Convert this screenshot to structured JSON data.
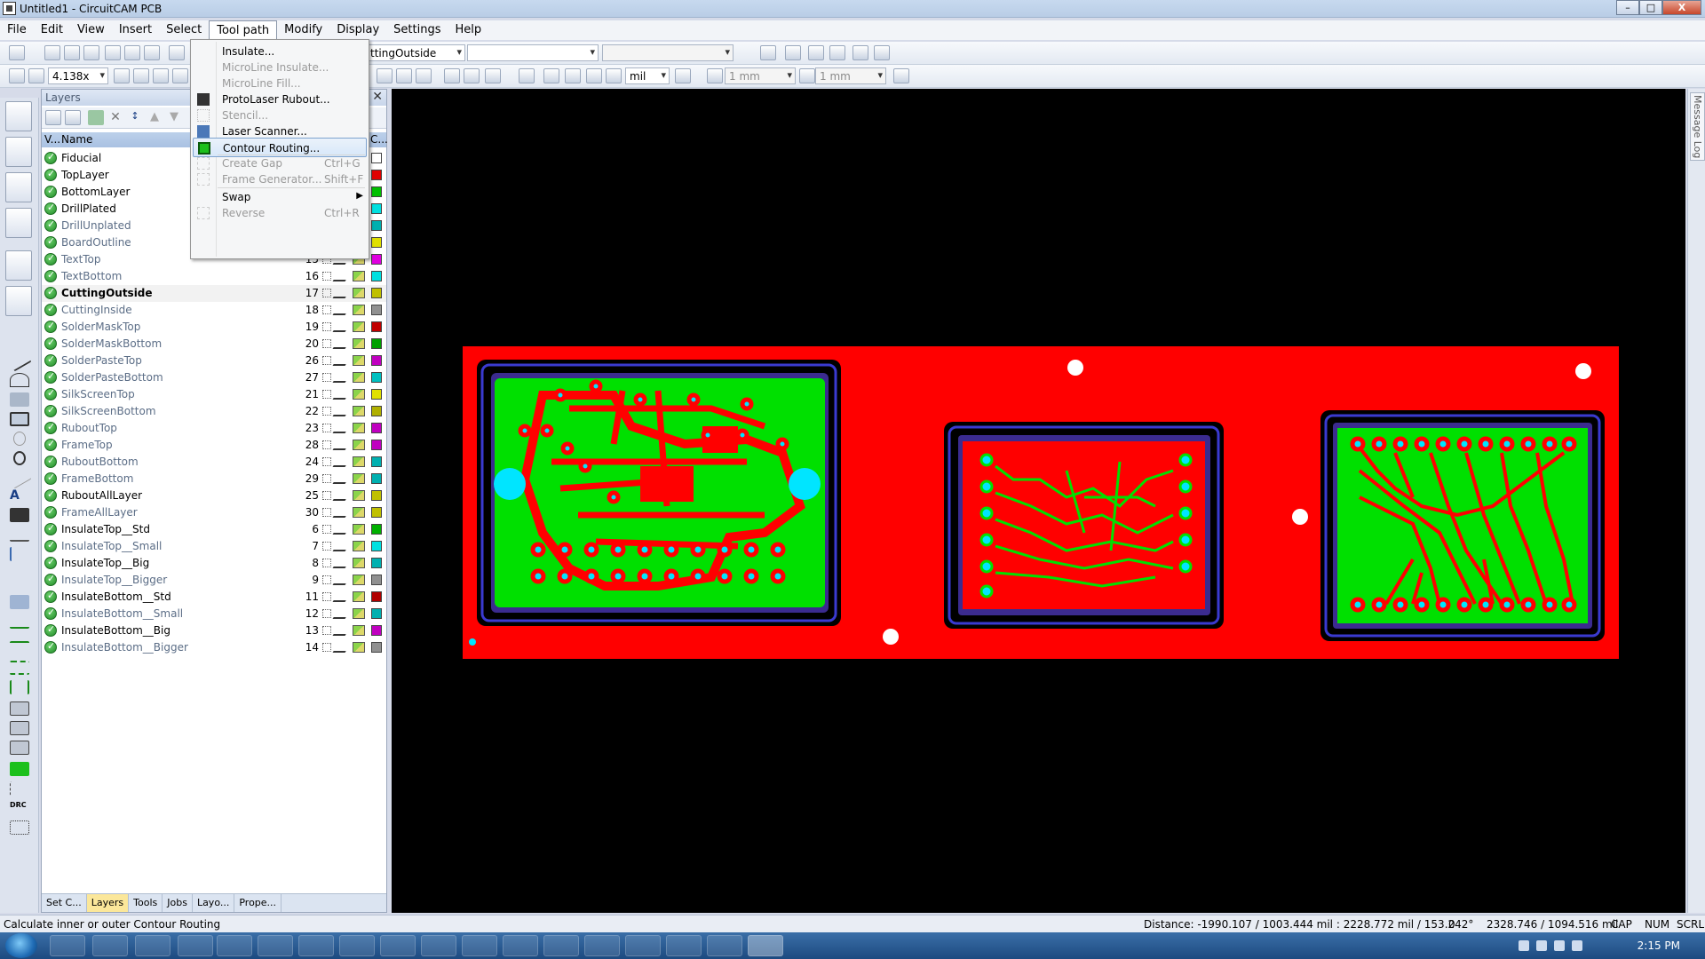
{
  "window": {
    "title": "Untitled1 - CircuitCAM PCB",
    "buttons": {
      "minimize": "–",
      "maximize": "□",
      "close": "X"
    }
  },
  "menubar": {
    "items": [
      "File",
      "Edit",
      "View",
      "Insert",
      "Select",
      "Tool path",
      "Modify",
      "Display",
      "Settings",
      "Help"
    ],
    "open_item": "Tool path"
  },
  "toolpath_menu": {
    "items": [
      {
        "label": "Insulate...",
        "shortcut": "",
        "enabled": true,
        "icon": "insulate-icon"
      },
      {
        "label": "MicroLine Insulate...",
        "shortcut": "",
        "enabled": false,
        "icon": ""
      },
      {
        "label": "MicroLine Fill...",
        "shortcut": "",
        "enabled": false,
        "icon": ""
      },
      {
        "label": "ProtoLaser Rubout...",
        "shortcut": "",
        "enabled": true,
        "icon": "rubout-icon"
      },
      {
        "label": "Stencil...",
        "shortcut": "",
        "enabled": false,
        "icon": "stencil-icon"
      },
      {
        "label": "Laser Scanner...",
        "shortcut": "",
        "enabled": true,
        "icon": "laser-scanner-icon"
      },
      {
        "label": "Contour Routing...",
        "shortcut": "",
        "enabled": true,
        "highlighted": true,
        "icon": "contour-routing-icon"
      },
      {
        "label": "Create Gap",
        "shortcut": "Ctrl+G",
        "enabled": false,
        "icon": "create-gap-icon"
      },
      {
        "label": "Frame Generator...",
        "shortcut": "Shift+F",
        "enabled": false,
        "icon": "frame-generator-icon"
      },
      {
        "label": "Swap",
        "shortcut": "",
        "enabled": true,
        "submenu": true,
        "icon": ""
      },
      {
        "label": "Reverse",
        "shortcut": "Ctrl+R",
        "enabled": false,
        "icon": "reverse-icon"
      }
    ]
  },
  "toolbar": {
    "layer_combo": "ttingOutside",
    "zoom_combo": "4.138x",
    "unit_combo": "mil",
    "grid_combo": "1 mm",
    "snap_combo": "1 mm",
    "empty_combo": ""
  },
  "layers_panel": {
    "title": "Layers",
    "columns": {
      "visible": "V...",
      "name": "Name",
      "color": "C..."
    },
    "rows": [
      {
        "name": "Fiducial",
        "num": "",
        "color": "#ffffff",
        "style": "bold"
      },
      {
        "name": "TopLayer",
        "num": "",
        "color": "#e00000",
        "style": "bold"
      },
      {
        "name": "BottomLayer",
        "num": "",
        "color": "#00c000",
        "style": "bold"
      },
      {
        "name": "DrillPlated",
        "num": "",
        "color": "#00e0e0",
        "style": "bold"
      },
      {
        "name": "DrillUnplated",
        "num": "",
        "color": "#00b0b0",
        "style": "dim"
      },
      {
        "name": "BoardOutline",
        "num": "",
        "color": "#e0e000",
        "style": "dim"
      },
      {
        "name": "TextTop",
        "num": "15",
        "color": "#e000e0",
        "style": "dim"
      },
      {
        "name": "TextBottom",
        "num": "16",
        "color": "#00e0e0",
        "style": "dim"
      },
      {
        "name": "CuttingOutside",
        "num": "17",
        "color": "#c0c000",
        "style": "bold",
        "selected": true
      },
      {
        "name": "CuttingInside",
        "num": "18",
        "color": "#909090",
        "style": "dim"
      },
      {
        "name": "SolderMaskTop",
        "num": "19",
        "color": "#c00000",
        "style": "dim"
      },
      {
        "name": "SolderMaskBottom",
        "num": "20",
        "color": "#00a000",
        "style": "dim"
      },
      {
        "name": "SolderPasteTop",
        "num": "26",
        "color": "#c000c0",
        "style": "dim"
      },
      {
        "name": "SolderPasteBottom",
        "num": "27",
        "color": "#00c0c0",
        "style": "dim"
      },
      {
        "name": "SilkScreenTop",
        "num": "21",
        "color": "#e0e000",
        "style": "dim"
      },
      {
        "name": "SilkScreenBottom",
        "num": "22",
        "color": "#b0b000",
        "style": "dim"
      },
      {
        "name": "RuboutTop",
        "num": "23",
        "color": "#c000c0",
        "style": "dim"
      },
      {
        "name": "FrameTop",
        "num": "28",
        "color": "#c000c0",
        "style": "dim"
      },
      {
        "name": "RuboutBottom",
        "num": "24",
        "color": "#00b0b0",
        "style": "dim"
      },
      {
        "name": "FrameBottom",
        "num": "29",
        "color": "#00b0b0",
        "style": "dim"
      },
      {
        "name": "RuboutAllLayer",
        "num": "25",
        "color": "#c0c000",
        "style": "bold"
      },
      {
        "name": "FrameAllLayer",
        "num": "30",
        "color": "#c0c000",
        "style": "dim"
      },
      {
        "name": "InsulateTop__Std",
        "num": "6",
        "color": "#00b000",
        "style": "bold"
      },
      {
        "name": "InsulateTop__Small",
        "num": "7",
        "color": "#00e0e0",
        "style": "dim"
      },
      {
        "name": "InsulateTop__Big",
        "num": "8",
        "color": "#00b0b0",
        "style": "bold"
      },
      {
        "name": "InsulateTop__Bigger",
        "num": "9",
        "color": "#909090",
        "style": "dim"
      },
      {
        "name": "InsulateBottom__Std",
        "num": "11",
        "color": "#b00000",
        "style": "bold"
      },
      {
        "name": "InsulateBottom__Small",
        "num": "12",
        "color": "#00b0b0",
        "style": "dim"
      },
      {
        "name": "InsulateBottom__Big",
        "num": "13",
        "color": "#c000c0",
        "style": "bold"
      },
      {
        "name": "InsulateBottom__Bigger",
        "num": "14",
        "color": "#909090",
        "style": "dim"
      }
    ],
    "tabs": [
      "Set C...",
      "Layers",
      "Tools",
      "Jobs",
      "Layo...",
      "Prope..."
    ],
    "active_tab": "Layers"
  },
  "message_log": {
    "label": "Message Log"
  },
  "statusbar": {
    "hint": "Calculate inner or outer Contour Routing",
    "distance": "Distance: -1990.107 / 1003.444 mil : 2228.772 mil / 153.242°",
    "zero": "0",
    "coords": "2328.746 / 1094.516 mil",
    "cap": "CAP",
    "num": "NUM",
    "scrl": "SCRL"
  },
  "taskbar": {
    "clock": "2:15 PM"
  },
  "colors": {
    "board_red": "#ff0000",
    "copper_green": "#00e000",
    "pad_cyan": "#00e5ff",
    "canvas_bg": "#000000"
  }
}
